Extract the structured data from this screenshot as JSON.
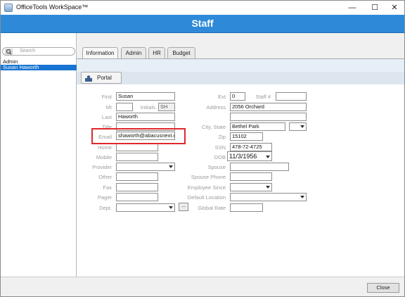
{
  "window": {
    "title": "OfficeTools WorkSpace™",
    "minimize": "—",
    "maximize": "☐",
    "close": "✕"
  },
  "header": {
    "title": "Staff"
  },
  "sidebar": {
    "search_placeholder": "Search",
    "items": [
      "Admin",
      "Susan  Haworth"
    ]
  },
  "tabs": [
    "Information",
    "Admin",
    "HR",
    "Budget"
  ],
  "subtab": {
    "label": "Portal"
  },
  "form": {
    "first": {
      "label": "First",
      "value": "Susan"
    },
    "mi": {
      "label": "MI",
      "value": ""
    },
    "initials": {
      "label": "Initials",
      "value": "SH"
    },
    "last": {
      "label": "Last",
      "value": "Haworth"
    },
    "title": {
      "label": "Title",
      "value": ""
    },
    "email": {
      "label": "Email",
      "value": "shaworth@abacusnext.com"
    },
    "home": {
      "label": "Home",
      "value": ""
    },
    "mobile": {
      "label": "Mobile",
      "value": ""
    },
    "provider": {
      "label": "Provider",
      "value": ""
    },
    "other": {
      "label": "Other",
      "value": ""
    },
    "fax": {
      "label": "Fax",
      "value": ""
    },
    "pager": {
      "label": "Pager",
      "value": ""
    },
    "dept": {
      "label": "Dept.",
      "value": "",
      "browse": "..."
    },
    "ext": {
      "label": "Ext",
      "value": "0"
    },
    "staff_no": {
      "label": "Staff #",
      "value": ""
    },
    "address": {
      "label": "Address",
      "value": "2056 Orchard"
    },
    "address2": {
      "value": ""
    },
    "city_state": {
      "label": "City, State",
      "value": "Bethel Park",
      "state": ""
    },
    "zip": {
      "label": "Zip",
      "value": "15102"
    },
    "ssn": {
      "label": "SSN",
      "value": "478-72-4725"
    },
    "dob": {
      "label": "DOB",
      "value": "11/3/1956"
    },
    "spouse": {
      "label": "Spouse",
      "value": ""
    },
    "spouse_phone": {
      "label": "Spouse Phone",
      "value": ""
    },
    "employee_since": {
      "label": "Employee Since",
      "value": ""
    },
    "default_location": {
      "label": "Default Location",
      "value": ""
    },
    "global_rate": {
      "label": "Global Rate",
      "value": ""
    }
  },
  "footer": {
    "close_label": "Close"
  },
  "colors": {
    "header": "#2e8ad8",
    "selection": "#1874d2",
    "highlight": "#e0282b"
  }
}
